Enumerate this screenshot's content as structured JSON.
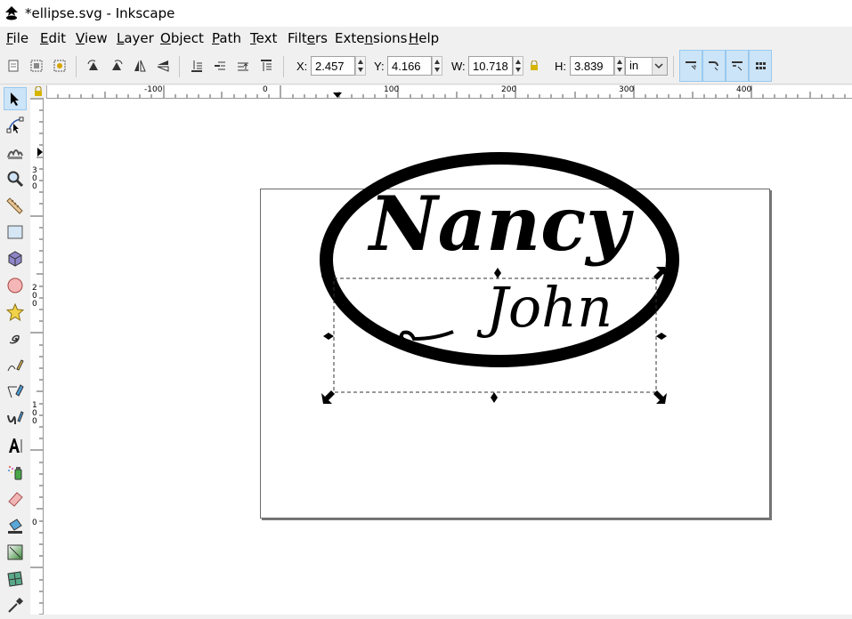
{
  "window": {
    "title": "*ellipse.svg - Inkscape"
  },
  "menu": [
    "File",
    "Edit",
    "View",
    "Layer",
    "Object",
    "Path",
    "Text",
    "Filters",
    "Extensions",
    "Help"
  ],
  "menu_mnemonic_index": [
    0,
    0,
    0,
    0,
    0,
    0,
    0,
    4,
    4,
    0
  ],
  "toolbar": {
    "x_label": "X:",
    "x_value": "2.457",
    "y_label": "Y:",
    "y_value": "4.166",
    "w_label": "W:",
    "w_value": "10.718",
    "h_label": "H:",
    "h_value": "3.839",
    "unit": "in"
  },
  "ruler": {
    "top_labels": [
      "-100",
      "0",
      "100",
      "200",
      "300",
      "400"
    ],
    "left_labels": [
      "300",
      "200",
      "100",
      "0"
    ]
  },
  "canvas": {
    "text_name": "Nancy",
    "text_surname": "John"
  },
  "colors": {
    "selected_tool_bg": "#cce4f7",
    "selected_tool_border": "#99c9ef",
    "ink": "#000000"
  },
  "icons": {
    "tools": [
      "selector-icon",
      "node-editor-icon",
      "tweak-icon",
      "zoom-icon",
      "measure-icon",
      "rectangle-icon",
      "3d-box-icon",
      "ellipse-icon",
      "star-icon",
      "spiral-icon",
      "pencil-icon",
      "pen-icon",
      "calligraphy-icon",
      "text-icon",
      "spray-icon",
      "eraser-icon",
      "paint-bucket-icon",
      "gradient-icon",
      "mesh-icon",
      "dropper-icon"
    ]
  }
}
